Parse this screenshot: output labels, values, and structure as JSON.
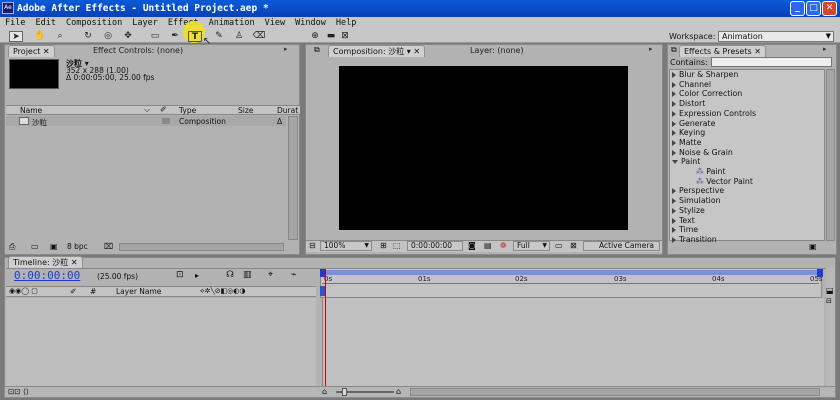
{
  "window": {
    "title": "Adobe After Effects - Untitled Project.aep *",
    "min": "_",
    "max": "□",
    "close": "✕"
  },
  "menu": [
    "File",
    "Edit",
    "Composition",
    "Layer",
    "Effect",
    "Animation",
    "View",
    "Window",
    "Help"
  ],
  "workspace": {
    "label": "Workspace:",
    "value": "Animation"
  },
  "project": {
    "tab": "Project",
    "effect_controls_tab": "Effect Controls: (none)",
    "item_name": "沙粒 ▾",
    "dims": "352 x 288 (1.00)",
    "duration": "Δ 0:00:05:00, 25.00 fps",
    "columns": {
      "name": "Name",
      "type": "Type",
      "size": "Size",
      "duration": "Durat"
    },
    "rows": [
      {
        "name": "沙粒",
        "type": "Composition",
        "duration": "Δ"
      }
    ],
    "bpc": "8 bpc"
  },
  "composition": {
    "tab": "Composition: 沙粒",
    "layer_tab": "Layer: (none)",
    "zoom": "100%",
    "timecode": "0:00:00:00",
    "resolution": "Full",
    "camera": "Active Camera"
  },
  "effects": {
    "tab": "Effects & Presets",
    "contains_label": "Contains:",
    "items": [
      {
        "label": "Blur & Sharpen",
        "open": false,
        "child": false
      },
      {
        "label": "Channel",
        "open": false,
        "child": false
      },
      {
        "label": "Color Correction",
        "open": false,
        "child": false
      },
      {
        "label": "Distort",
        "open": false,
        "child": false
      },
      {
        "label": "Expression Controls",
        "open": false,
        "child": false
      },
      {
        "label": "Generate",
        "open": false,
        "child": false
      },
      {
        "label": "Keying",
        "open": false,
        "child": false
      },
      {
        "label": "Matte",
        "open": false,
        "child": false
      },
      {
        "label": "Noise & Grain",
        "open": false,
        "child": false
      },
      {
        "label": "Paint",
        "open": true,
        "child": false
      },
      {
        "label": "Paint",
        "open": false,
        "child": true
      },
      {
        "label": "Vector Paint",
        "open": false,
        "child": true
      },
      {
        "label": "Perspective",
        "open": false,
        "child": false
      },
      {
        "label": "Simulation",
        "open": false,
        "child": false
      },
      {
        "label": "Stylize",
        "open": false,
        "child": false
      },
      {
        "label": "Text",
        "open": false,
        "child": false
      },
      {
        "label": "Time",
        "open": false,
        "child": false
      },
      {
        "label": "Transition",
        "open": false,
        "child": false
      }
    ]
  },
  "timeline": {
    "tab": "Timeline: 沙粒",
    "timecode": "0:00:00:00",
    "fps": "(25.00 fps)",
    "layer_name_header": "Layer Name",
    "hash_header": "#",
    "ticks": [
      "0s",
      "01s",
      "02s",
      "03s",
      "04s",
      "05s"
    ]
  },
  "colors": {
    "titlebar": "#0a4ccc",
    "timecode": "#1a3fd0",
    "playhead": "#d00000",
    "highlight": "#f3e01e"
  }
}
